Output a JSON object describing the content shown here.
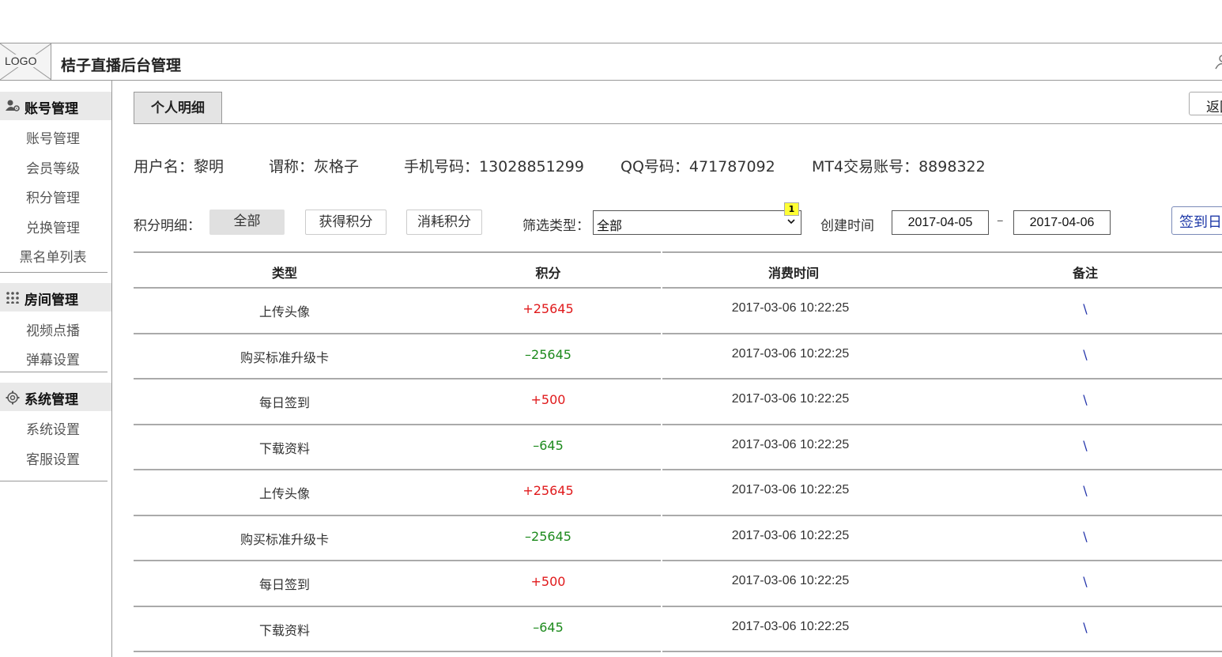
{
  "header": {
    "logo_text": "LOGO",
    "app_title": "桔子直播后台管理"
  },
  "sidebar": {
    "groups": [
      {
        "title": "账号管理",
        "icon": "user-gear-icon",
        "items": [
          "账号管理",
          "会员等级",
          "积分管理",
          "兑换管理",
          "黑名单列表"
        ]
      },
      {
        "title": "房间管理",
        "icon": "grid-dots-icon",
        "items": [
          "视频点播",
          "弹幕设置"
        ]
      },
      {
        "title": "系统管理",
        "icon": "gear-icon",
        "items": [
          "系统设置",
          "客服设置"
        ]
      }
    ]
  },
  "main": {
    "tab": "个人明细",
    "back_label": "返回",
    "info": {
      "username": "用户名：黎明",
      "nickname": "谓称：灰格子",
      "phone": "手机号码：13028851299",
      "qq": "QQ号码：471787092",
      "mt4": "MT4交易账号：8898322"
    },
    "filters": {
      "label": "积分明细：",
      "buttons": [
        "全部",
        "获得积分",
        "消耗积分"
      ],
      "active": "全部",
      "type_label": "筛选类型：",
      "type_value": "全部",
      "badge": "1",
      "created_label": "创建时间",
      "date_from": "2017-04-05",
      "date_sep": "–",
      "date_to": "2017-04-06",
      "signin_label": "签到日志"
    },
    "table": {
      "headers": [
        "类型",
        "积分",
        "消费时间",
        "备注"
      ],
      "rows": [
        {
          "type": "上传头像",
          "points": "+25645",
          "sign": "pos",
          "time": "2017-03-06 10:22:25",
          "note": "\\"
        },
        {
          "type": "购买标准升级卡",
          "points": "–25645",
          "sign": "neg",
          "time": "2017-03-06 10:22:25",
          "note": "\\"
        },
        {
          "type": "每日签到",
          "points": "+500",
          "sign": "pos",
          "time": "2017-03-06 10:22:25",
          "note": "\\"
        },
        {
          "type": "下载资料",
          "points": "–645",
          "sign": "neg",
          "time": "2017-03-06 10:22:25",
          "note": "\\"
        },
        {
          "type": "上传头像",
          "points": "+25645",
          "sign": "pos",
          "time": "2017-03-06 10:22:25",
          "note": "\\"
        },
        {
          "type": "购买标准升级卡",
          "points": "–25645",
          "sign": "neg",
          "time": "2017-03-06 10:22:25",
          "note": "\\"
        },
        {
          "type": "每日签到",
          "points": "+500",
          "sign": "pos",
          "time": "2017-03-06 10:22:25",
          "note": "\\"
        },
        {
          "type": "下载资料",
          "points": "–645",
          "sign": "neg",
          "time": "2017-03-06 10:22:25",
          "note": "\\"
        }
      ]
    },
    "colors": {
      "positive": "#e0191b",
      "negative": "#1c8a1c",
      "note": "#2233aa",
      "accent_button": "#1f3aa8"
    }
  }
}
